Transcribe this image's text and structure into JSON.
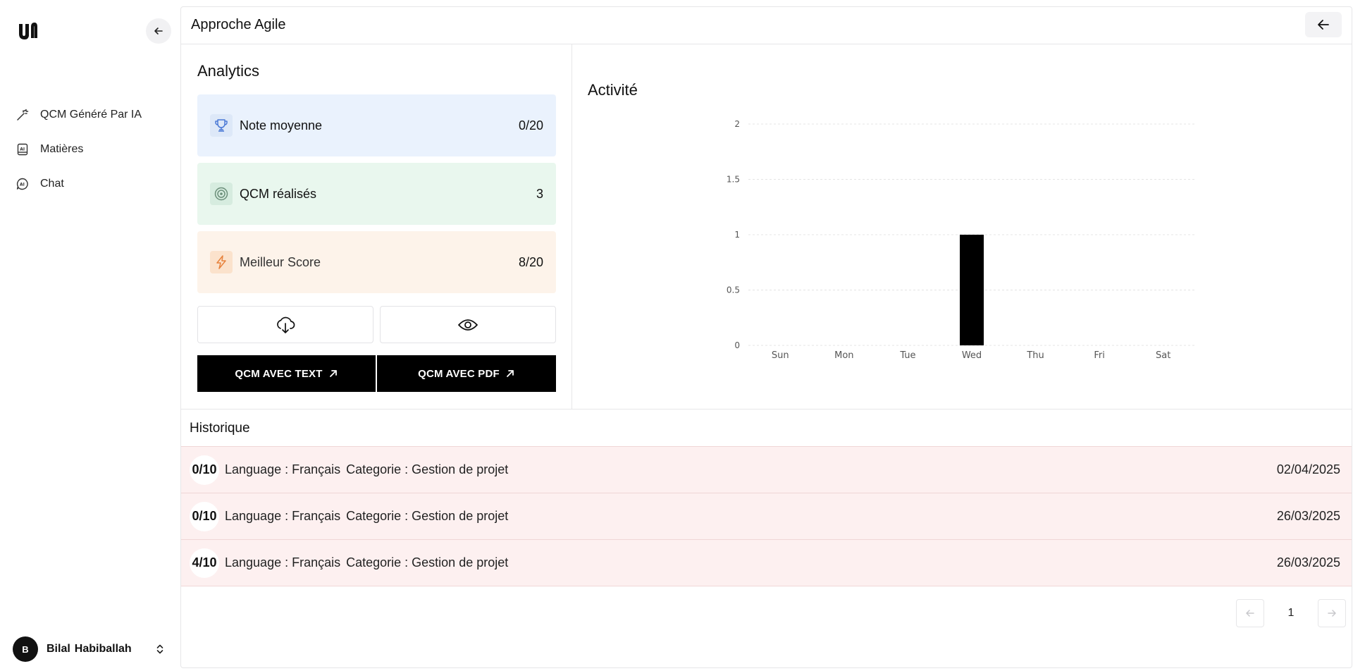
{
  "sidebar": {
    "logo": "logo-icon",
    "nav": [
      {
        "label": "QCM Généré Par IA",
        "icon": "magic-wand-icon"
      },
      {
        "label": "Matières",
        "icon": "book-icon"
      },
      {
        "label": "Chat",
        "icon": "ai-chat-icon"
      }
    ],
    "user": {
      "initial": "B",
      "first_name": "Bilal",
      "last_name": "Habiballah"
    }
  },
  "header": {
    "title": "Approche Agile"
  },
  "analytics": {
    "title": "Analytics",
    "stats": [
      {
        "label": "Note moyenne",
        "value": "0/20",
        "icon": "trophy-icon",
        "color": "#4a78d6"
      },
      {
        "label": "QCM réalisés",
        "value": "3",
        "icon": "target-icon",
        "color": "#6b8f7a"
      },
      {
        "label": "Meilleur Score",
        "value": "8/20",
        "icon": "lightning-icon",
        "color": "#e8823c"
      }
    ],
    "buttons": {
      "qcm_text": "QCM AVEC TEXT",
      "qcm_pdf": "QCM AVEC PDF"
    }
  },
  "activity": {
    "title": "Activité"
  },
  "chart_data": {
    "type": "bar",
    "categories": [
      "Sun",
      "Mon",
      "Tue",
      "Wed",
      "Thu",
      "Fri",
      "Sat"
    ],
    "values": [
      0,
      0,
      0,
      1,
      0,
      0,
      0
    ],
    "ylim": [
      0,
      2
    ],
    "yticks": [
      "0",
      "0.5",
      "1",
      "1.5",
      "2"
    ],
    "grid": true,
    "bar_color": "#000000"
  },
  "historique": {
    "title": "Historique",
    "rows": [
      {
        "score": "0/10",
        "language": "Language : Français",
        "category": "Categorie : Gestion de projet",
        "date": "02/04/2025"
      },
      {
        "score": "0/10",
        "language": "Language : Français",
        "category": "Categorie : Gestion de projet",
        "date": "26/03/2025"
      },
      {
        "score": "4/10",
        "language": "Language : Français",
        "category": "Categorie : Gestion de projet",
        "date": "26/03/2025"
      }
    ]
  },
  "pagination": {
    "current": "1"
  }
}
